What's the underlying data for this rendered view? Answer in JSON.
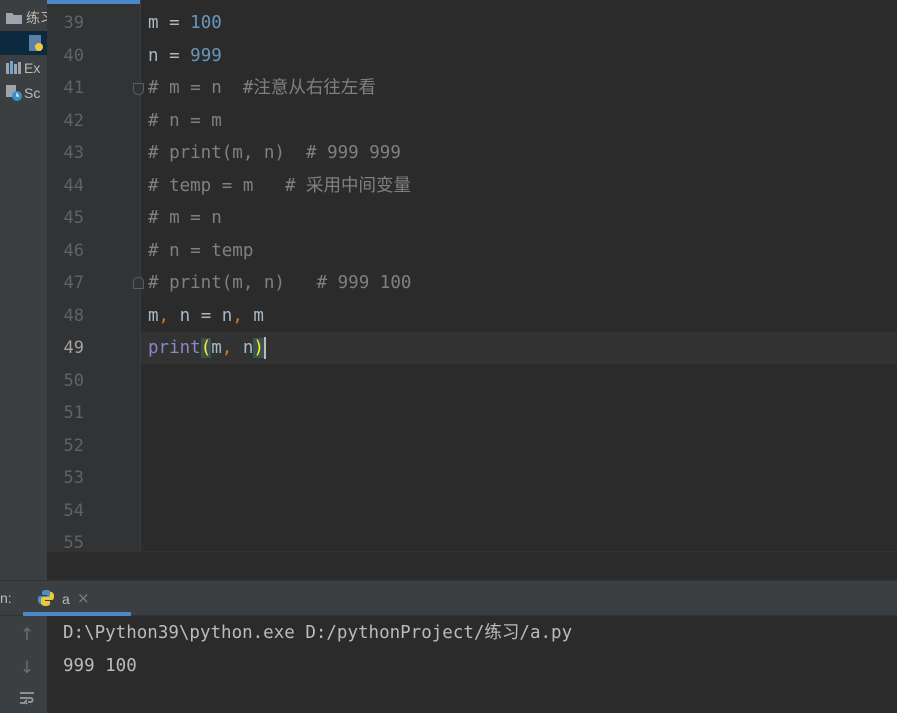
{
  "project_panel": {
    "items": [
      {
        "label": "练习",
        "icon": "folder-icon"
      },
      {
        "label": "",
        "icon": "python-file-icon"
      },
      {
        "label": "Ex",
        "icon": "external-libraries-icon"
      },
      {
        "label": "Sc",
        "icon": "scratches-icon"
      }
    ]
  },
  "editor": {
    "line_numbers": [
      "39",
      "40",
      "41",
      "42",
      "43",
      "44",
      "45",
      "46",
      "47",
      "48",
      "49",
      "50",
      "51",
      "52",
      "53",
      "54",
      "55"
    ],
    "current_line": "49",
    "lines": [
      {
        "a": "m = ",
        "b": "100"
      },
      {
        "a": "n = ",
        "b": "999"
      },
      {
        "text": "# m = n  #注意从右往左看"
      },
      {
        "text": "# n = m"
      },
      {
        "text": "# print(m, n)  # 999 999"
      },
      {
        "text": "# temp = m   # 采用中间变量"
      },
      {
        "text": "# m = n"
      },
      {
        "text": "# n = temp"
      },
      {
        "text": "# print(m, n)   # 999 100"
      },
      {
        "a": "m",
        "p1": ",",
        "b": " n = n",
        "p2": ",",
        "c": " m"
      },
      {
        "fn": "print",
        "open": "(",
        "args1": "m",
        "comma": ",",
        "args2": " n",
        "close": ")"
      }
    ]
  },
  "run_panel": {
    "label": "n:",
    "tab_name": "a",
    "tab_close": "×",
    "tab_icon": "python-file-icon",
    "toolbar": {
      "up": "↑",
      "down": "↓",
      "wrap": "soft-wrap-icon"
    },
    "output": [
      "D:\\Python39\\python.exe D:/pythonProject/练习/a.py",
      "999 100"
    ]
  },
  "colors": {
    "background": "#2b2b2b",
    "comment": "#808080",
    "number": "#6897bb",
    "keyword_punct": "#cc7832",
    "builtin": "#8888c6",
    "accent": "#4a88c7"
  }
}
